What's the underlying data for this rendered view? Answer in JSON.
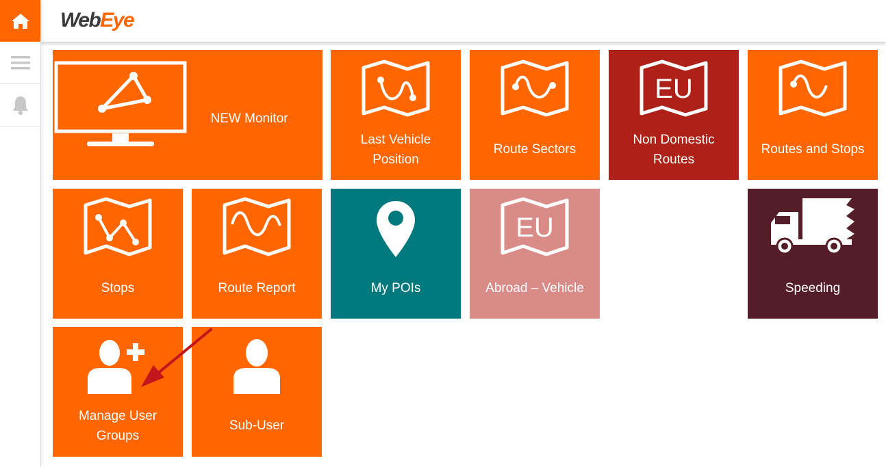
{
  "header": {
    "logo_part1": "Web",
    "logo_part2": "Eye"
  },
  "sidebar": {
    "items": [
      {
        "icon": "home-icon",
        "active": true
      },
      {
        "icon": "menu-icon",
        "active": false
      },
      {
        "icon": "bell-icon",
        "active": false
      }
    ]
  },
  "tiles": {
    "new_monitor": {
      "label": "NEW Monitor",
      "icon": "monitor-icon",
      "color": "#ff6600"
    },
    "last_vehicle_position": {
      "label_line1": "Last Vehicle",
      "label_line2": "Position",
      "icon": "map-route-icon",
      "color": "#ff6600"
    },
    "route_sectors": {
      "label": "Route Sectors",
      "icon": "map-route-icon",
      "color": "#ff6600"
    },
    "non_domestic_routes": {
      "label_line1": "Non Domestic",
      "label_line2": "Routes",
      "icon": "eu-map-icon",
      "color": "#ad2118",
      "icon_text": "EU"
    },
    "routes_and_stops": {
      "label": "Routes and Stops",
      "icon": "map-route-icon",
      "color": "#ff6600"
    },
    "stops": {
      "label": "Stops",
      "icon": "map-stops-icon",
      "color": "#ff6600"
    },
    "route_report": {
      "label": "Route Report",
      "icon": "map-wave-icon",
      "color": "#ff6600"
    },
    "my_pois": {
      "label": "My POIs",
      "icon": "map-pin-icon",
      "color": "#00797c"
    },
    "abroad_vehicle": {
      "label": "Abroad – Vehicle",
      "icon": "eu-map-icon",
      "color": "#d98c87",
      "icon_text": "EU"
    },
    "speeding": {
      "label": "Speeding",
      "icon": "truck-icon",
      "color": "#541d27"
    },
    "manage_user_groups": {
      "label_line1": "Manage User",
      "label_line2": "Groups",
      "icon": "user-add-icon",
      "color": "#ff6600"
    },
    "sub_user": {
      "label": "Sub-User",
      "icon": "user-icon",
      "color": "#ff6600"
    }
  },
  "annotation": {
    "arrow_color": "#c0161c"
  }
}
